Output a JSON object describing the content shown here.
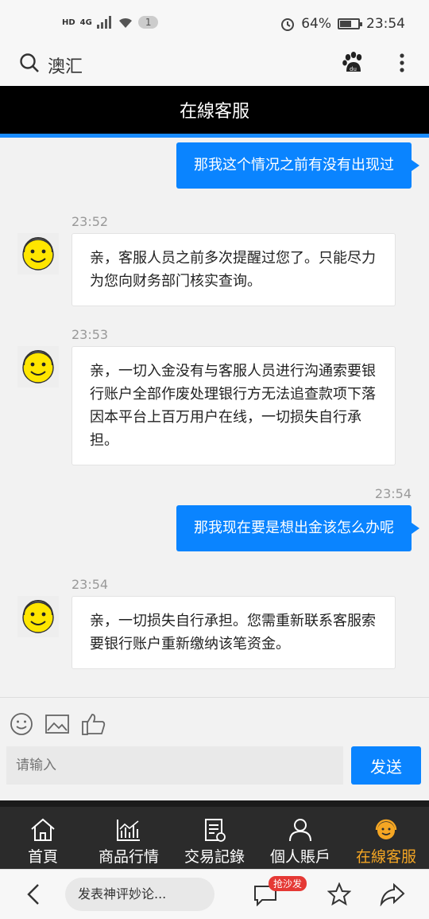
{
  "status_bar": {
    "hd": "HD",
    "network": "4G",
    "notification_count": "1",
    "battery_percent": "64%",
    "battery_level": 0.64,
    "time": "23:54"
  },
  "browser": {
    "search_query": "澳汇",
    "comment_placeholder": "发表神评妙论...",
    "hot_badge": "抢沙发"
  },
  "page": {
    "title": "在線客服"
  },
  "messages": [
    {
      "from": "user",
      "text": "那我这个情况之前有没有出现过"
    },
    {
      "from": "bot",
      "time": "23:52",
      "text": "亲，客服人员之前多次提醒过您了。只能尽力为您向财务部门核实查询。"
    },
    {
      "from": "bot",
      "time": "23:53",
      "text": "亲，一切入金没有与客服人员进行沟通索要银行账户全部作废处理银行方无法追查款项下落因本平台上百万用户在线，一切损失自行承担。"
    },
    {
      "from": "user",
      "time": "23:54",
      "text": "那我现在要是想出金该怎么办呢"
    },
    {
      "from": "bot",
      "time": "23:54",
      "text": "亲，一切损失自行承担。您需重新联系客服索要银行账户重新缴纳该笔资金。"
    }
  ],
  "input": {
    "placeholder": "请输入",
    "send_label": "发送"
  },
  "tabs": [
    {
      "label": "首頁",
      "icon": "home-icon"
    },
    {
      "label": "商品行情",
      "icon": "chart-icon"
    },
    {
      "label": "交易記錄",
      "icon": "records-icon"
    },
    {
      "label": "個人賬戶",
      "icon": "user-icon"
    },
    {
      "label": "在線客服",
      "icon": "headset-icon",
      "active": true
    }
  ],
  "colors": {
    "accent": "#0a84ff",
    "header_bg": "#000000",
    "tab_active": "#f5a623"
  }
}
